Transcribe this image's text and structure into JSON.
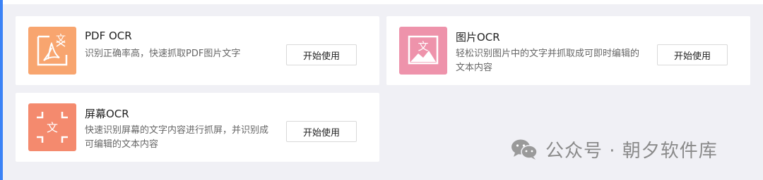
{
  "cards": [
    {
      "id": "pdf",
      "icon": "pdf-ocr-icon",
      "title": "PDF OCR",
      "description": "识别正确率高，快速抓取PDF图片文字",
      "button": "开始使用",
      "color": "#f8a56f"
    },
    {
      "id": "image",
      "icon": "image-ocr-icon",
      "title": "图片OCR",
      "description": "轻松识别图片中的文字并抓取成可即时编辑的文本内容",
      "button": "开始使用",
      "color": "#ee93ab"
    },
    {
      "id": "screen",
      "icon": "screen-ocr-icon",
      "title": "屏幕OCR",
      "description": "快速识别屏幕的文字内容进行抓屏，并识别成可编辑的文本内容",
      "button": "开始使用",
      "color": "#f48a6e"
    }
  ],
  "watermark": {
    "icon": "wechat-icon",
    "text": "公众号 · 朝夕软件库"
  }
}
